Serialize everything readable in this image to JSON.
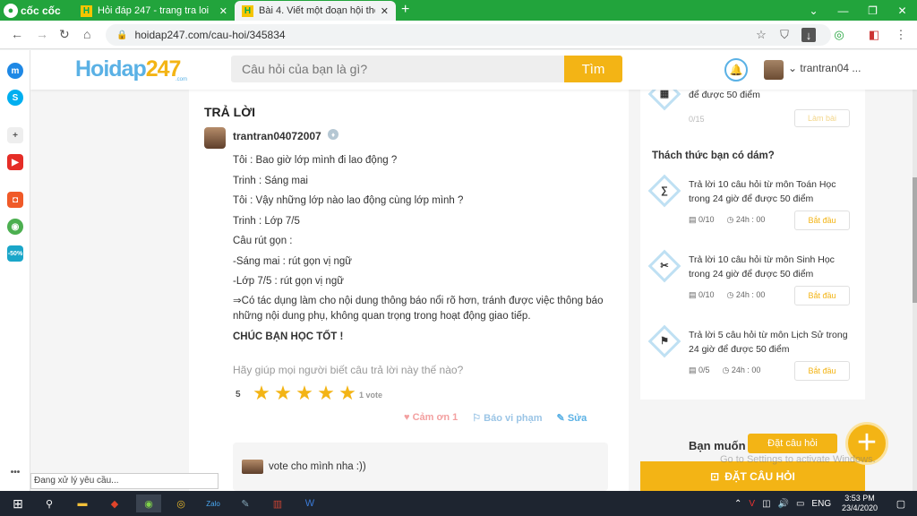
{
  "browser": {
    "brand": "cốc cốc",
    "tabs": [
      {
        "title": "Hỏi đáp 247 - trang tra loi"
      },
      {
        "title": "Bài 4. Viết một đoạn hội thoại"
      }
    ],
    "url": "hoidap247.com/cau-hoi/345834",
    "status_text": "Đang xử lý yêu cầu..."
  },
  "site": {
    "brand_a": "Hoidap",
    "brand_b": "247",
    "brand_sub": ".com",
    "search_placeholder": "Câu hỏi của bạn là gì?",
    "search_button": "Tìm",
    "username": "trantran04 ..."
  },
  "answer": {
    "section_title": "TRẢ LỜI",
    "author": "trantran04072007",
    "lines": [
      "Tôi : Bao giờ lớp mình đi lao động ?",
      "Trinh : Sáng mai",
      "Tôi : Vậy những lớp nào lao động cùng lớp mình ?",
      "Trinh : Lớp 7/5",
      "Câu rút gọn :",
      "-Sáng mai : rút gọn vị ngữ",
      "-Lớp 7/5 : rút gọn vị ngữ"
    ],
    "conclusion": "⇒Có tác dụng làm cho nội dung thông báo nổi rõ hơn, tránh được việc thông báo những nội dung phụ, không quan trọng trong hoạt động giao tiếp.",
    "signoff": "CHÚC BẠN HỌC TỐT !",
    "help_text": "Hãy giúp mọi người biết câu trả lời này thế nào?",
    "rating": "5",
    "stars_filled": 5,
    "votes": "1 vote",
    "thanks": "Cảm ơn 1",
    "report": "Báo vi phạm",
    "edit": "Sửa",
    "comment": "vote cho mình nha :))"
  },
  "sidebar_right": {
    "top_text": "để được 50 điểm",
    "top_meta": "0/15",
    "top_button": "Làm bài",
    "challenge_title": "Thách thức bạn có dám?",
    "challenges": [
      {
        "icon": "∑",
        "text": "Trả lời 10 câu hỏi  từ môn Toán Học  trong 24 giờ để được 50 điểm",
        "progress": "0/10",
        "time": "24h : 00",
        "button": "Bắt đầu"
      },
      {
        "icon": "✂",
        "text": "Trả lời 10 câu hỏi  từ môn Sinh Học  trong 24 giờ để được 50 điểm",
        "progress": "0/10",
        "time": "24h : 00",
        "button": "Bắt đầu"
      },
      {
        "icon": "⚑",
        "text": "Trả lời 5 câu hỏi  từ môn Lịch Sử  trong 24 giờ để được 50 điểm",
        "progress": "0/5",
        "time": "24h : 00",
        "button": "Bắt đầu"
      }
    ],
    "ban_muon": "Bạn muốn",
    "ask_bar": "ĐẶT CÂU HỎI",
    "float_label": "Đặt câu hỏi",
    "activate": "Go to Settings to activate Windows."
  },
  "taskbar": {
    "lang": "ENG",
    "time": "3:53 PM",
    "date": "23/4/2020"
  }
}
